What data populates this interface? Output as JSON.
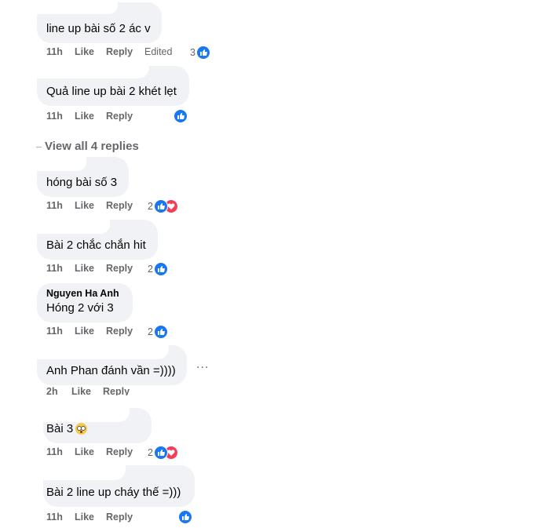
{
  "comments": [
    {
      "text": "line up bài số 2 ác v",
      "time": "11h",
      "like": "Like",
      "reply": "Reply",
      "edited": "Edited",
      "reaction_count": "3",
      "reactions": [
        "like"
      ]
    },
    {
      "text": "Quả line up bài 2 khét lẹt",
      "time": "11h",
      "like": "Like",
      "reply": "Reply",
      "reaction_count": "",
      "reactions": [
        "like"
      ]
    },
    {
      "text": "hóng bài số 3",
      "time": "11h",
      "like": "Like",
      "reply": "Reply",
      "reaction_count": "2",
      "reactions": [
        "like",
        "love"
      ]
    },
    {
      "text": "Bài 2 chắc chắn hit",
      "time": "11h",
      "like": "Like",
      "reply": "Reply",
      "reaction_count": "2",
      "reactions": [
        "like"
      ]
    },
    {
      "author": "Nguyen Ha Anh",
      "text": "Hóng 2 với 3",
      "time": "11h",
      "like": "Like",
      "reply": "Reply",
      "reaction_count": "2",
      "reactions": [
        "like"
      ]
    },
    {
      "text": "Anh Phan đánh vần =))))",
      "time": "2h",
      "like": "Like",
      "reply": "Reply",
      "more": "..."
    },
    {
      "text": "Bài 3",
      "emoji": "flushed-face",
      "time": "11h",
      "like": "Like",
      "reply": "Reply",
      "reaction_count": "2",
      "reactions": [
        "like",
        "love"
      ]
    },
    {
      "text": "Bài 2 line up cháy thế =)))",
      "time": "11h",
      "like": "Like",
      "reply": "Reply",
      "reaction_count": "",
      "reactions": [
        "like"
      ]
    }
  ],
  "view_replies": "View all 4 replies",
  "colors": {
    "bubble": "#f0f2f5",
    "meta": "#65676b",
    "like": "#1877f2",
    "love": "#f33e58"
  }
}
